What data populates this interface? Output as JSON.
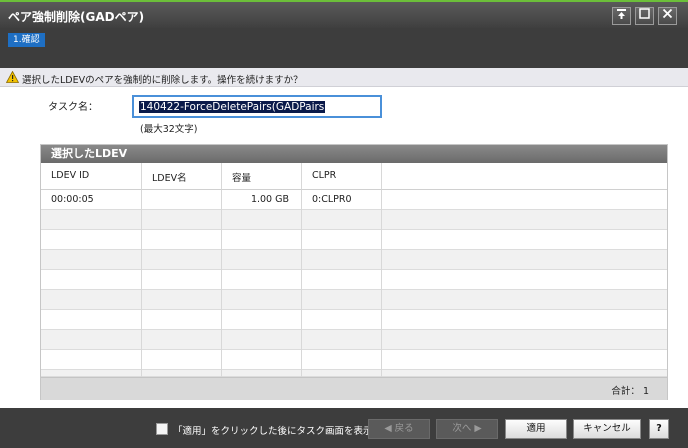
{
  "window": {
    "title": "ペア強制削除(GADペア)"
  },
  "step": {
    "label": "1.確認"
  },
  "warning": {
    "text": "選択したLDEVのペアを強制的に削除します。操作を続けますか？"
  },
  "task": {
    "label": "タスク名：",
    "value": "140422-ForceDeletePairs(GADPairs",
    "hint": "(最大32文字)"
  },
  "table": {
    "title": "選択したLDEV",
    "columns": [
      "LDEV ID",
      "LDEV名",
      "容量",
      "CLPR"
    ],
    "rows": [
      {
        "ldev_id": "00:00:05",
        "ldev_name": "",
        "capacity": "1.00 GB",
        "clpr": "0:CLPR0"
      }
    ],
    "total_label": "合計：",
    "total_value": "1"
  },
  "footer": {
    "checkbox_label": "「適用」をクリックした後にタスク画面を表示",
    "back": "◀ 戻る",
    "next": "次へ ▶",
    "apply": "適用",
    "cancel": "キャンセル",
    "help": "?"
  }
}
